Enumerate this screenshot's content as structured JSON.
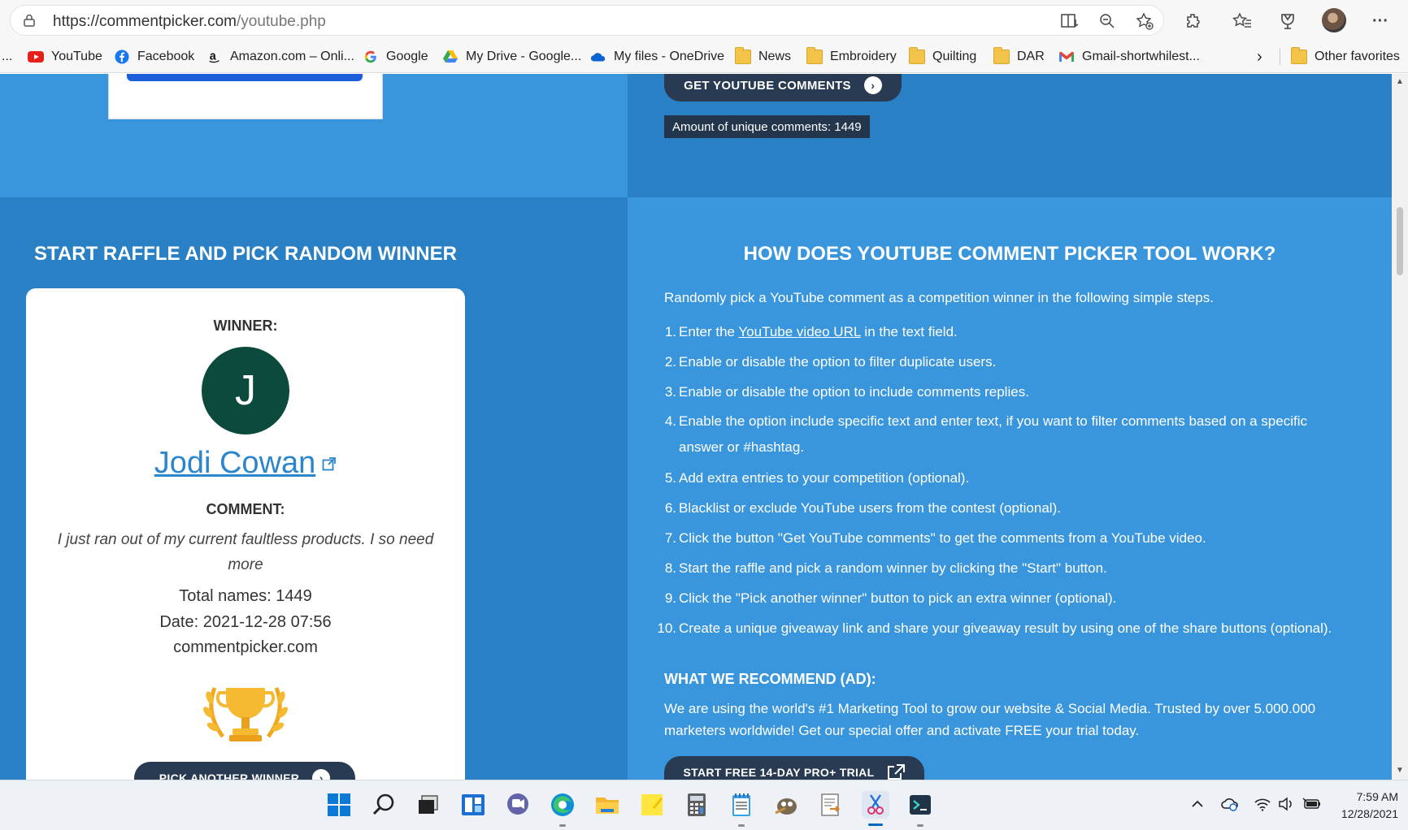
{
  "browser": {
    "url_host": "https://commentpicker.com",
    "url_path": "/youtube.php",
    "favorites": [
      {
        "label": "YouTube",
        "icon": "youtube-icon"
      },
      {
        "label": "Facebook",
        "icon": "facebook-icon"
      },
      {
        "label": "Amazon.com – Onli...",
        "icon": "amazon-icon"
      },
      {
        "label": "Google",
        "icon": "google-icon"
      },
      {
        "label": "My Drive - Google...",
        "icon": "google-drive-icon"
      },
      {
        "label": "My files - OneDrive",
        "icon": "onedrive-icon"
      },
      {
        "label": "News",
        "icon": "folder-icon"
      },
      {
        "label": "Embroidery",
        "icon": "folder-icon"
      },
      {
        "label": "Quilting",
        "icon": "folder-icon"
      },
      {
        "label": "DAR",
        "icon": "folder-icon"
      },
      {
        "label": "Gmail-shortwhilest...",
        "icon": "gmail-icon"
      }
    ],
    "other_favorites": "Other favorites",
    "leading_ellipsis": "..."
  },
  "top": {
    "get_comments_label": "GET YOUTUBE COMMENTS",
    "amount_label": "Amount of unique comments: 1449"
  },
  "left": {
    "heading": "START RAFFLE AND PICK RANDOM WINNER",
    "winner_label": "WINNER:",
    "avatar_initial": "J",
    "winner_name": "Jodi Cowan",
    "comment_label": "COMMENT:",
    "comment_text": "I just ran out of my current faultless products. I so need more",
    "total_names": "Total names: 1449",
    "date": "Date: 2021-12-28 07:56",
    "site": "commentpicker.com",
    "pick_another_label": "PICK ANOTHER WINNER"
  },
  "right": {
    "heading": "HOW DOES YOUTUBE COMMENT PICKER TOOL WORK?",
    "intro": "Randomly pick a YouTube comment as a competition winner in the following simple steps.",
    "step1_before": "Enter the ",
    "step1_link": "YouTube video URL",
    "step1_after": " in the text field.",
    "steps": [
      "Enable or disable the option to filter duplicate users.",
      "Enable or disable the option to include comments replies.",
      "Enable the option include specific text and enter text, if you want to filter comments based on a specific answer or #hashtag.",
      "Add extra entries to your competition (optional).",
      "Blacklist or exclude YouTube users from the contest (optional).",
      "Click the button \"Get YouTube comments\" to get the comments from a YouTube video.",
      "Start the raffle and pick a random winner by clicking the \"Start\" button.",
      "Click the \"Pick another winner\" button to pick an extra winner (optional).",
      "Create a unique giveaway link and share your giveaway result by using one of the share buttons (optional)."
    ],
    "recommend_title": "WHAT WE RECOMMEND (AD):",
    "recommend_text": "We are using the world's #1 Marketing Tool to grow our website & Social Media. Trusted by over 5.000.000 marketers worldwide! Get our special offer and activate FREE your trial today.",
    "trial_label": "START FREE 14-DAY PRO+ TRIAL"
  },
  "taskbar": {
    "time": "7:59 AM",
    "date": "12/28/2021"
  }
}
